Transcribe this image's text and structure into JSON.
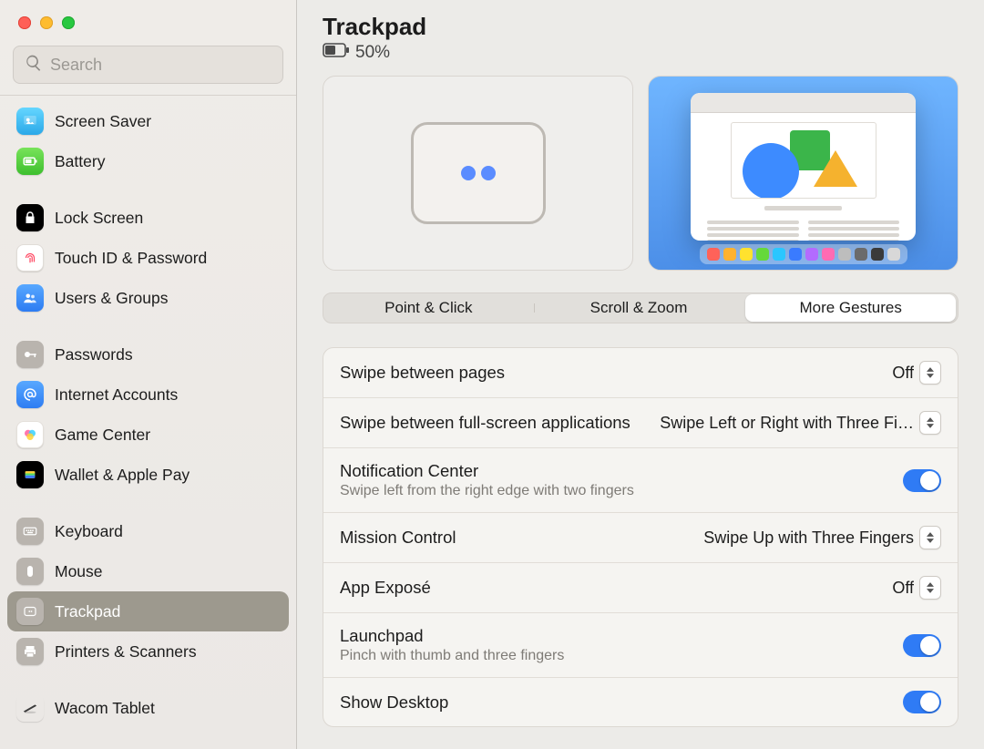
{
  "search": {
    "placeholder": "Search"
  },
  "sidebar": {
    "items": [
      {
        "id": "screen-saver",
        "label": "Screen Saver"
      },
      {
        "id": "battery",
        "label": "Battery"
      },
      {
        "id": "lock-screen",
        "label": "Lock Screen"
      },
      {
        "id": "touch-id",
        "label": "Touch ID & Password"
      },
      {
        "id": "users-groups",
        "label": "Users & Groups"
      },
      {
        "id": "passwords",
        "label": "Passwords"
      },
      {
        "id": "internet-accounts",
        "label": "Internet Accounts"
      },
      {
        "id": "game-center",
        "label": "Game Center"
      },
      {
        "id": "wallet-applepay",
        "label": "Wallet & Apple Pay"
      },
      {
        "id": "keyboard",
        "label": "Keyboard"
      },
      {
        "id": "mouse",
        "label": "Mouse"
      },
      {
        "id": "trackpad",
        "label": "Trackpad"
      },
      {
        "id": "printers-scanners",
        "label": "Printers & Scanners"
      },
      {
        "id": "wacom-tablet",
        "label": "Wacom Tablet"
      }
    ]
  },
  "header": {
    "title": "Trackpad",
    "battery_pct": "50%"
  },
  "tabs": [
    {
      "id": "point-click",
      "label": "Point & Click"
    },
    {
      "id": "scroll-zoom",
      "label": "Scroll & Zoom"
    },
    {
      "id": "more-gestures",
      "label": "More Gestures"
    }
  ],
  "settings": [
    {
      "id": "swipe-pages",
      "label": "Swipe between pages",
      "value": "Off",
      "control": "popup"
    },
    {
      "id": "swipe-fullscreen",
      "label": "Swipe between full-screen applications",
      "value": "Swipe Left or Right with Three Fi…",
      "control": "popup"
    },
    {
      "id": "notif-center",
      "label": "Notification Center",
      "sub": "Swipe left from the right edge with two fingers",
      "control": "toggle",
      "on": true
    },
    {
      "id": "mission-control",
      "label": "Mission Control",
      "value": "Swipe Up with Three Fingers",
      "control": "popup"
    },
    {
      "id": "app-expose",
      "label": "App Exposé",
      "value": "Off",
      "control": "popup"
    },
    {
      "id": "launchpad",
      "label": "Launchpad",
      "sub": "Pinch with thumb and three fingers",
      "control": "toggle",
      "on": true
    },
    {
      "id": "show-desktop",
      "label": "Show Desktop",
      "control": "toggle",
      "on": true
    }
  ],
  "dock_colors": [
    "#ff6259",
    "#ffb22e",
    "#ffe22e",
    "#65d93a",
    "#2ac6ff",
    "#3a7bff",
    "#b36bff",
    "#ff6bb3",
    "#bdbdbd",
    "#6b6b6b",
    "#3a3a3a",
    "#d8d8d8"
  ]
}
